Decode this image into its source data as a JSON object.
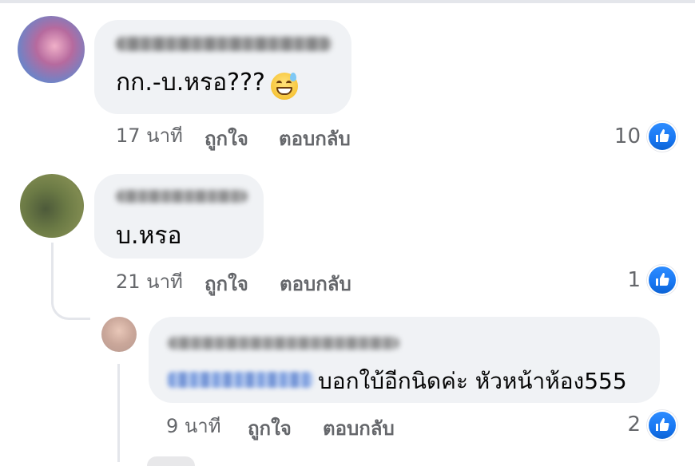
{
  "comments": [
    {
      "text": "กก.-บ.หรอ???",
      "emoji": "grinning-sweat-emoji",
      "time": "17 นาที",
      "like_label": "ถูกใจ",
      "reply_label": "ตอบกลับ",
      "reactions": "10"
    },
    {
      "text": "บ.หรอ",
      "time": "21 นาที",
      "like_label": "ถูกใจ",
      "reply_label": "ตอบกลับ",
      "reactions": "1"
    },
    {
      "text": "บอกใบ้อีกนิดค่ะ หัวหน้าห้อง555",
      "time": "9 นาที",
      "like_label": "ถูกใจ",
      "reply_label": "ตอบกลับ",
      "reactions": "2"
    }
  ],
  "icons": {
    "like_reaction": "thumbs-up-icon"
  },
  "colors": {
    "bubble": "#f0f2f5",
    "meta_text": "#65676b",
    "like_blue": "#1877f2"
  }
}
